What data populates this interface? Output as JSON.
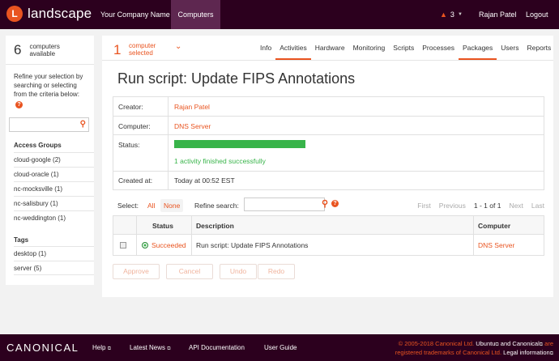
{
  "topbar": {
    "logo_letter": "L",
    "logo_text": "landscape",
    "company": "Your Company Name",
    "computers": "Computers",
    "alert_count": "3",
    "user": "Rajan Patel",
    "logout": "Logout"
  },
  "sidebar": {
    "count": "6",
    "count_label": "computers available",
    "refine_text": "Refine your selection by searching or selecting from the criteria below:",
    "help": "?",
    "access_groups_heading": "Access Groups",
    "access_groups": [
      "cloud-google (2)",
      "cloud-oracle (1)",
      "nc-mocksville (1)",
      "nc-salisbury (1)",
      "nc-weddington (1)"
    ],
    "tags_heading": "Tags",
    "tags": [
      "desktop (1)",
      "server (5)"
    ]
  },
  "selection": {
    "count": "1",
    "label": "computer selected"
  },
  "tabs": [
    "Info",
    "Activities",
    "Hardware",
    "Monitoring",
    "Scripts",
    "Processes",
    "Packages",
    "Users",
    "Reports"
  ],
  "active_tabs": [
    "Activities",
    "Packages"
  ],
  "page": {
    "title": "Run script: Update FIPS Annotations"
  },
  "info": {
    "creator_label": "Creator:",
    "creator": "Rajan Patel",
    "computer_label": "Computer:",
    "computer": "DNS Server",
    "status_label": "Status:",
    "progress": 1.0,
    "status_text": "1 activity finished successfully",
    "created_label": "Created at:",
    "created": "Today at 00:52 EST"
  },
  "filters": {
    "select_label": "Select:",
    "all": "All",
    "none": "None",
    "refine_label": "Refine search:",
    "refine_placeholder": "",
    "first": "First",
    "previous": "Previous",
    "range": "1 - 1 of 1",
    "next": "Next",
    "last": "Last"
  },
  "activities": {
    "headers": {
      "status": "Status",
      "description": "Description",
      "computer": "Computer"
    },
    "rows": [
      {
        "status": "Succeeded",
        "description": "Run script: Update FIPS Annotations",
        "computer": "DNS Server"
      }
    ]
  },
  "buttons": {
    "approve": "Approve",
    "cancel": "Cancel",
    "undo": "Undo",
    "redo": "Redo"
  },
  "footer": {
    "brand": "CANONICAL",
    "help": "Help",
    "news": "Latest News",
    "api": "API Documentation",
    "guide": "User Guide",
    "legal_1": "© 2005-2018 Canonical Ltd.",
    "legal_ubuntu": "Ubuntu",
    "legal_and": "and",
    "legal_canonical": "Canonical",
    "legal_are": "are",
    "legal_2": "registered trademarks of Canonical Ltd.",
    "legal_info": "Legal information"
  },
  "colors": {
    "brand": "#e95420",
    "topbar": "#2c001e",
    "success": "#38b44a"
  }
}
